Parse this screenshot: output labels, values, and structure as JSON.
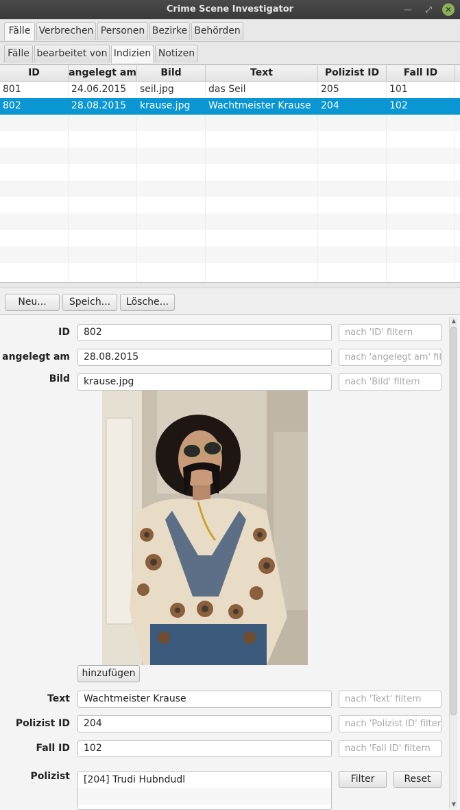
{
  "window": {
    "title": "Crime Scene Investigator"
  },
  "main_tabs": [
    "Fälle",
    "Verbrechen",
    "Personen",
    "Bezirke",
    "Behörden"
  ],
  "sub_tabs": [
    "Fälle",
    "bearbeitet von",
    "Indizien",
    "Notizen"
  ],
  "table": {
    "columns": [
      "ID",
      "angelegt am",
      "Bild",
      "Text",
      "Polizist ID",
      "Fall ID"
    ],
    "rows": [
      [
        "801",
        "24.06.2015",
        "seil.jpg",
        "das Seil",
        "205",
        "101"
      ],
      [
        "802",
        "28.08.2015",
        "krause.jpg",
        "Wachtmeister Krause",
        "204",
        "102"
      ]
    ],
    "selected_row": 1
  },
  "toolbar": {
    "new_label": "Neu...",
    "save_label": "Speich...",
    "delete_label": "Lösche..."
  },
  "form": {
    "id": {
      "label": "ID",
      "value": "802",
      "filter_placeholder": "nach 'ID' filtern"
    },
    "created": {
      "label": "angelegt am",
      "value": "28.08.2015",
      "filter_placeholder": "nach 'angelegt am' filtern"
    },
    "image": {
      "label": "Bild",
      "value": "krause.jpg",
      "filter_placeholder": "nach 'Bild' filtern",
      "add_label": "hinzufügen"
    },
    "text": {
      "label": "Text",
      "value": "Wachtmeister Krause",
      "filter_placeholder": "nach 'Text' filtern"
    },
    "officer_id": {
      "label": "Polizist ID",
      "value": "204",
      "filter_placeholder": "nach 'Polizist ID' filtern"
    },
    "case_id": {
      "label": "Fall ID",
      "value": "102",
      "filter_placeholder": "nach 'Fall ID' filtern"
    },
    "officer": {
      "label": "Polizist",
      "items": [
        "[204] Trudi Hubndudl"
      ],
      "filter_label": "Filter",
      "reset_label": "Reset"
    }
  },
  "colors": {
    "selection": "#0996d3",
    "titlebar": "#3c3c3c",
    "close_button": "#8bb158"
  }
}
